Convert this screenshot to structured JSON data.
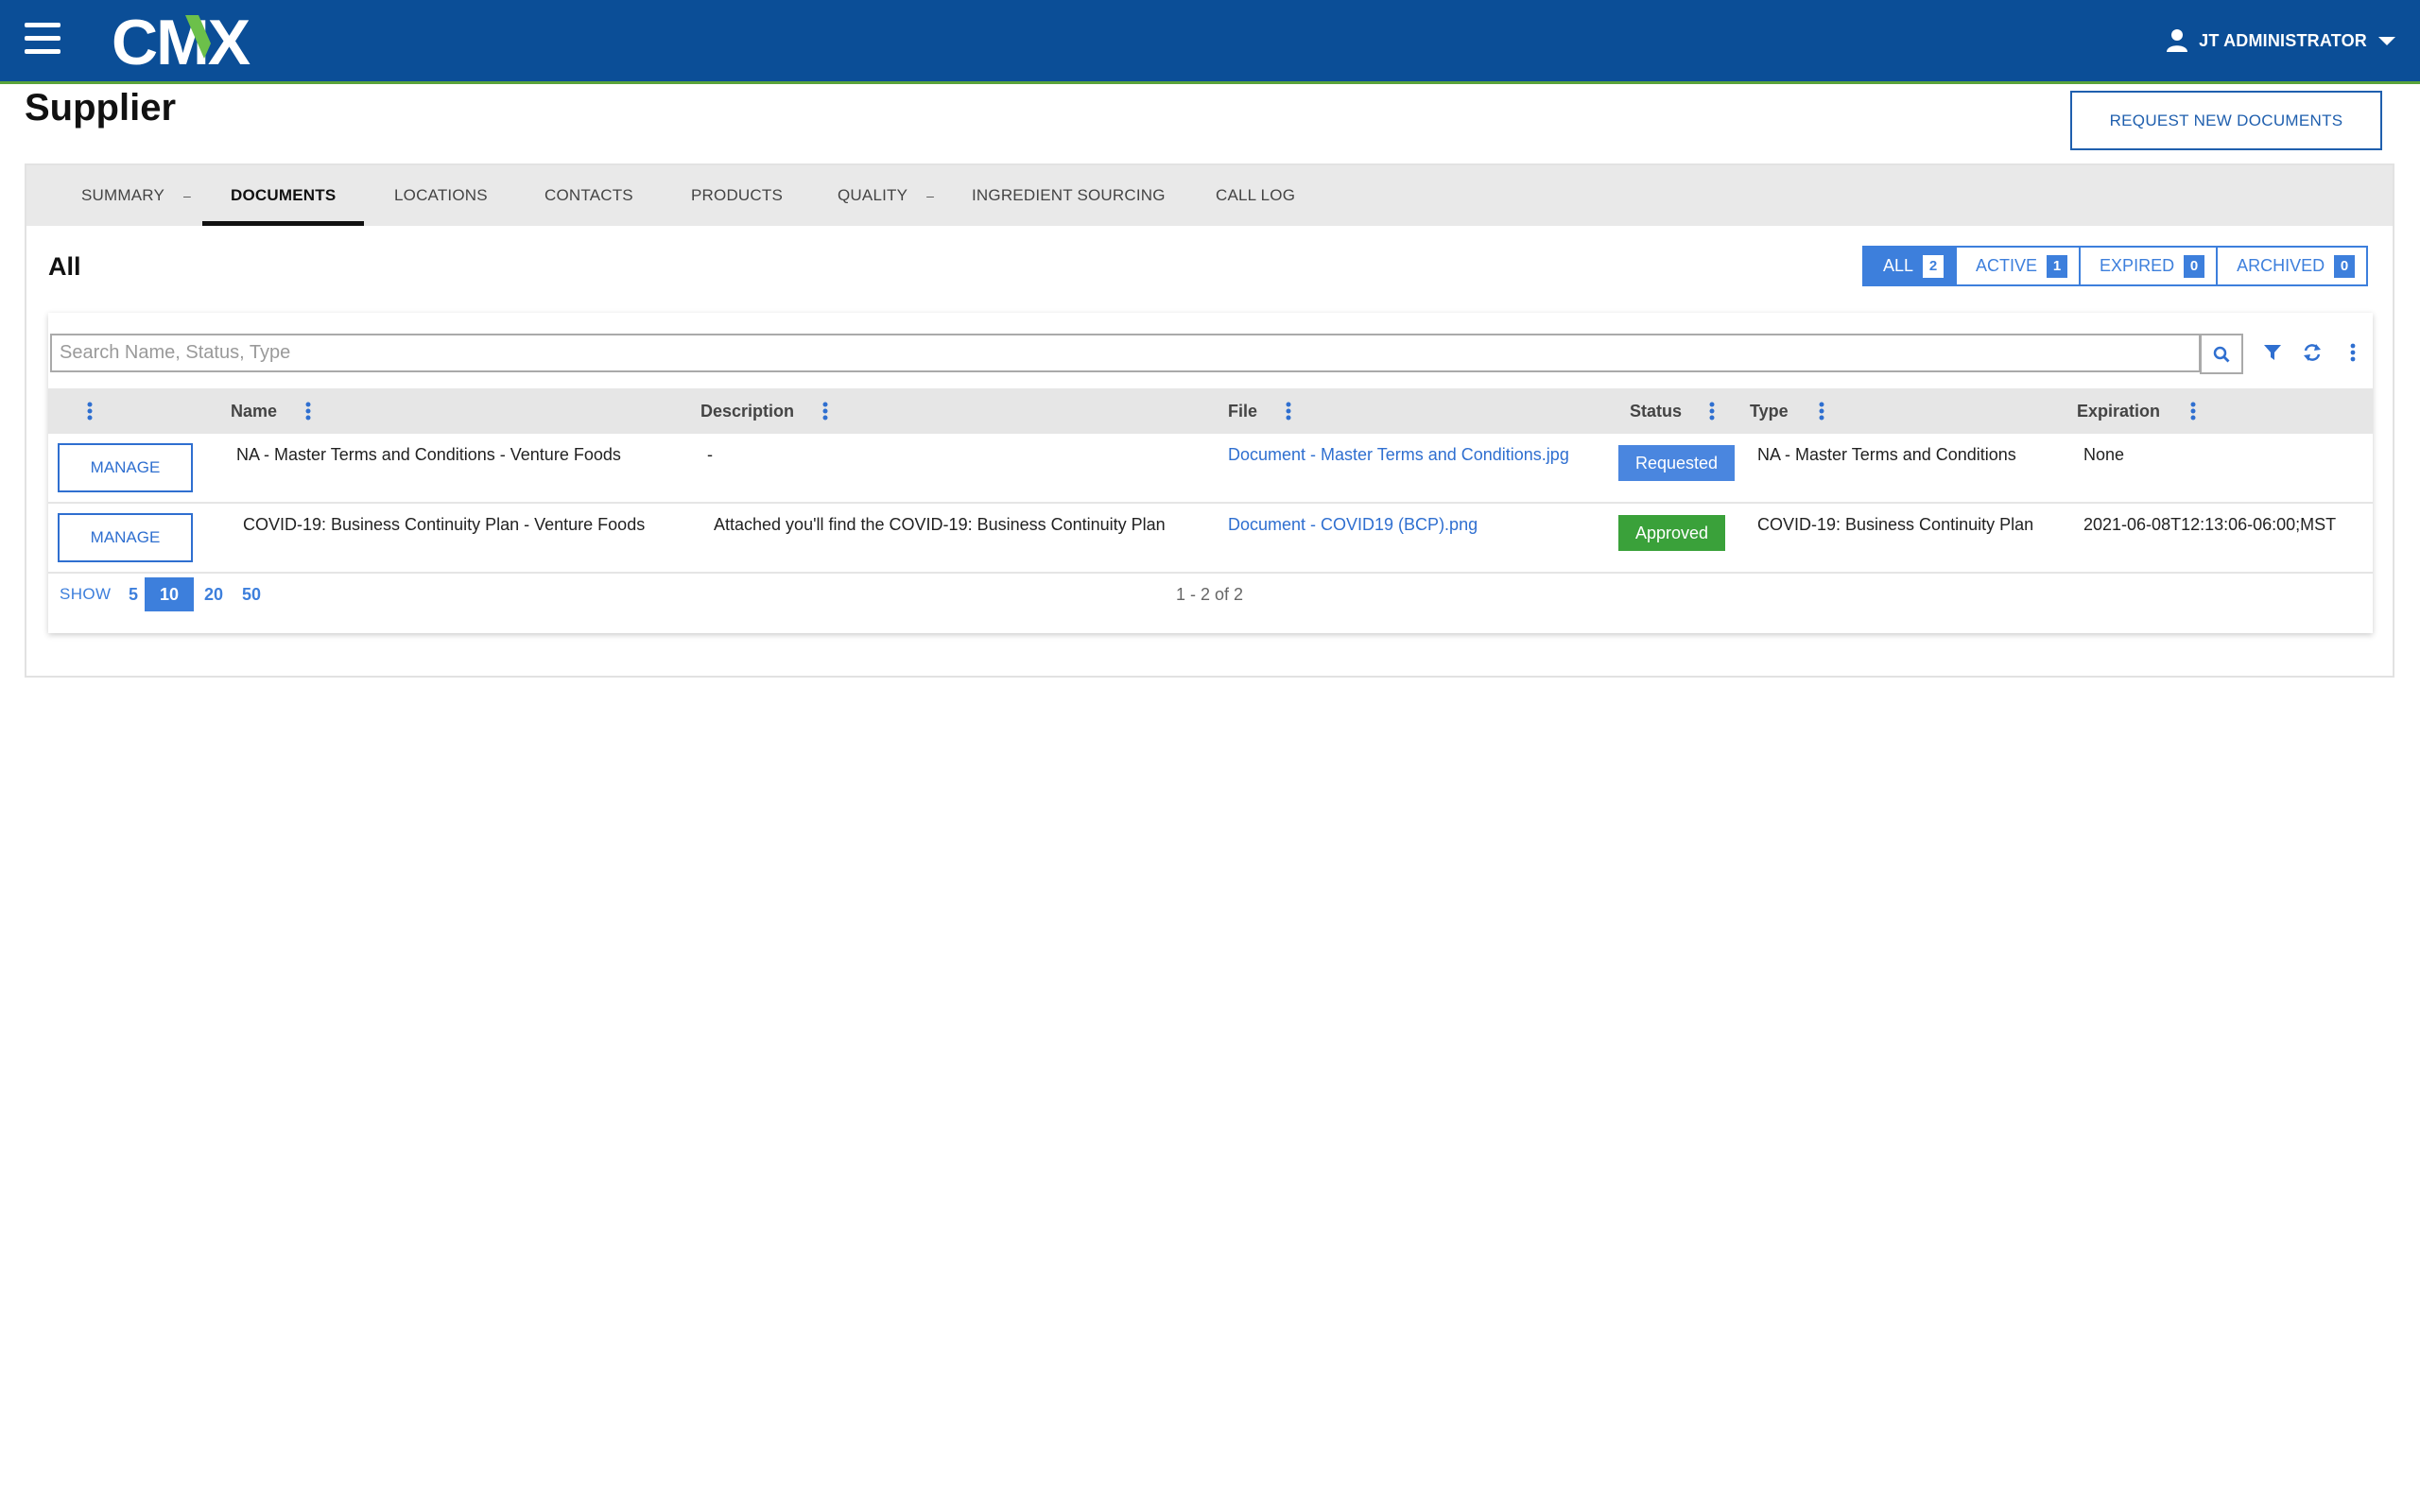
{
  "header": {
    "logo_text": "CMX",
    "user_name": "JT ADMINISTRATOR",
    "brand_color": "#0b4e97",
    "accent_color": "#5aa43a"
  },
  "page": {
    "title": "Supplier",
    "request_button": "REQUEST NEW DOCUMENTS"
  },
  "tabs": [
    {
      "label": "SUMMARY",
      "has_caret": true
    },
    {
      "label": "DOCUMENTS",
      "active": true
    },
    {
      "label": "LOCATIONS"
    },
    {
      "label": "CONTACTS"
    },
    {
      "label": "PRODUCTS"
    },
    {
      "label": "QUALITY",
      "has_caret": true
    },
    {
      "label": "INGREDIENT SOURCING"
    },
    {
      "label": "CALL LOG"
    }
  ],
  "section": {
    "title": "All",
    "filters": [
      {
        "label": "ALL",
        "count": "2",
        "active": true
      },
      {
        "label": "ACTIVE",
        "count": "1"
      },
      {
        "label": "EXPIRED",
        "count": "0"
      },
      {
        "label": "ARCHIVED",
        "count": "0"
      }
    ]
  },
  "grid": {
    "search_placeholder": "Search Name, Status, Type",
    "columns": [
      "Name",
      "Description",
      "File",
      "Status",
      "Type",
      "Expiration"
    ],
    "manage_label": "MANAGE",
    "rows": [
      {
        "name": "NA - Master Terms and Conditions - Venture Foods",
        "description": "-",
        "file": "Document - Master Terms and Conditions.jpg",
        "status": "Requested",
        "status_color": "#4a86df",
        "type": "NA - Master Terms and Conditions",
        "expiration": "None"
      },
      {
        "name": "COVID-19: Business Continuity Plan - Venture Foods",
        "description": "Attached you'll find the COVID-19: Business Continuity Plan",
        "file": "Document - COVID19 (BCP).png",
        "status": "Approved",
        "status_color": "#3aa13a",
        "type": "COVID-19: Business Continuity Plan",
        "expiration": "2021-06-08T12:13:06-06:00;MST"
      }
    ],
    "pager": {
      "show_label": "SHOW",
      "sizes": [
        "5",
        "10",
        "20",
        "50"
      ],
      "active_size": "10",
      "range": "1 - 2 of 2"
    }
  }
}
